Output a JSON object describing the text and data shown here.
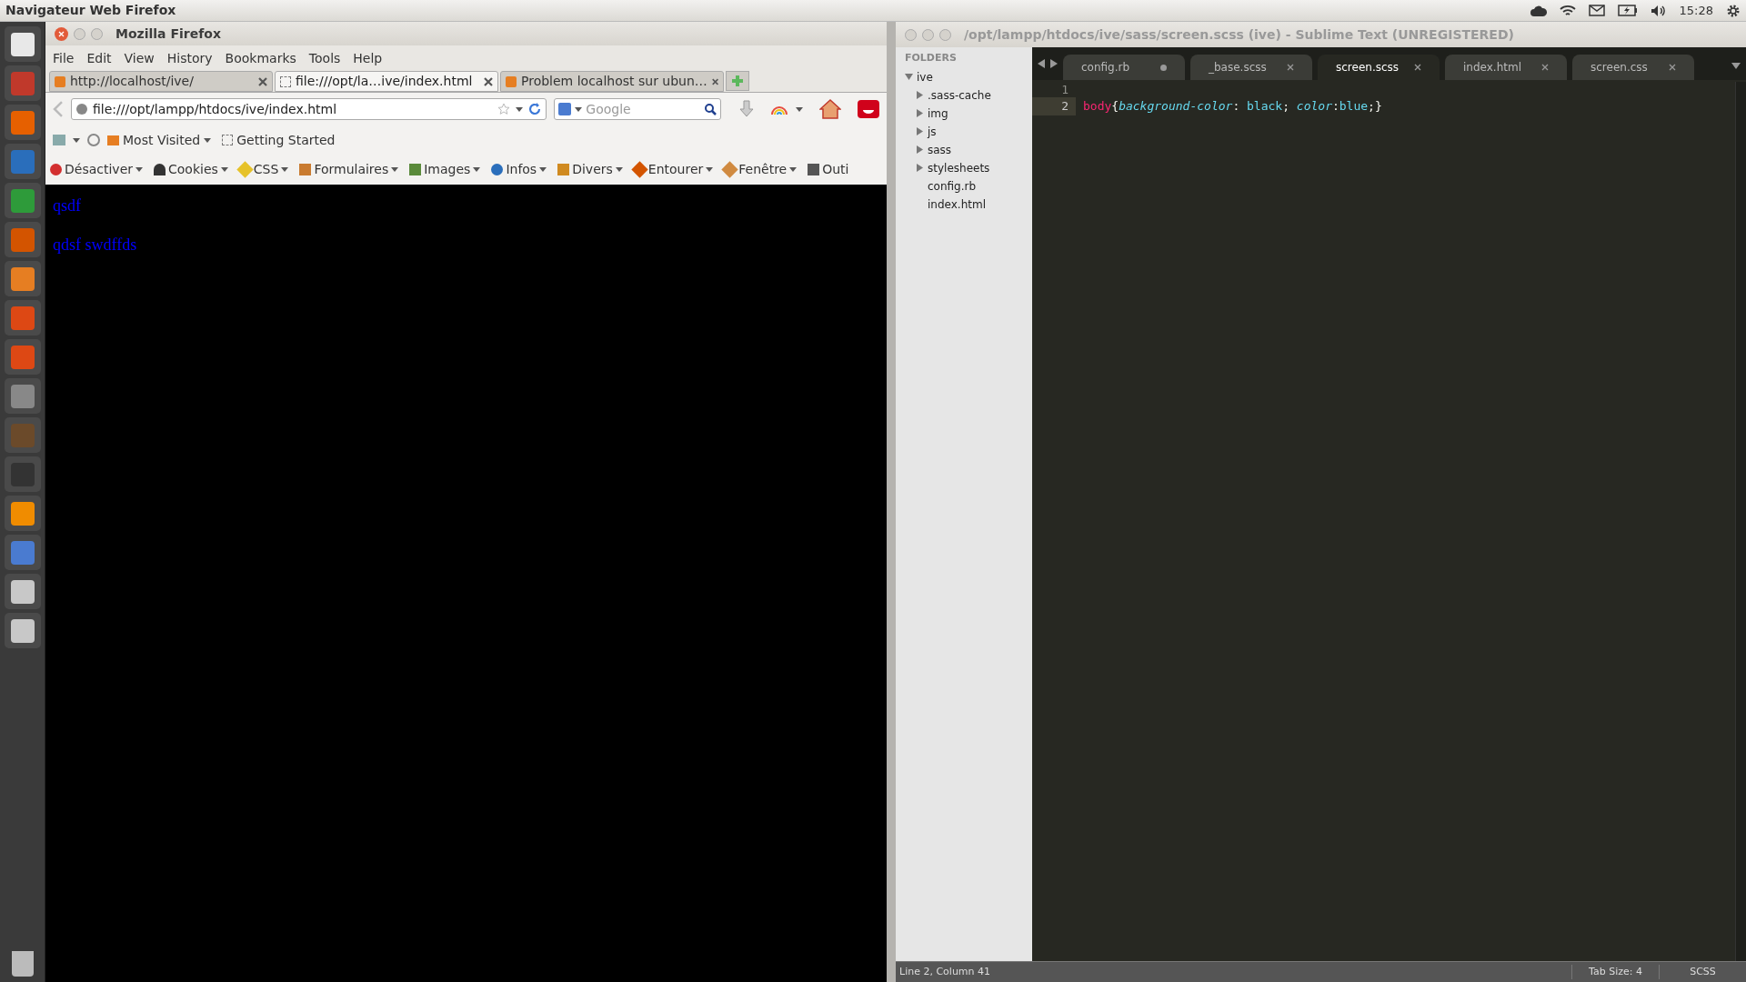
{
  "top_panel": {
    "title": "Navigateur Web Firefox",
    "time": "15:28"
  },
  "firefox": {
    "title": "Mozilla Firefox",
    "menu": [
      "File",
      "Edit",
      "View",
      "History",
      "Bookmarks",
      "Tools",
      "Help"
    ],
    "tabs": [
      {
        "label": "http://localhost/ive/",
        "selected": false
      },
      {
        "label": "file:///opt/la…ive/index.html",
        "selected": true
      },
      {
        "label": "Problem localhost sur ubun…",
        "selected": false
      }
    ],
    "url": "file:///opt/lampp/htdocs/ive/index.html",
    "search": {
      "placeholder": "Google"
    },
    "bookmarks": [
      "Most Visited",
      "Getting Started"
    ],
    "devtools": [
      "Désactiver",
      "Cookies",
      "CSS",
      "Formulaires",
      "Images",
      "Infos",
      "Divers",
      "Entourer",
      "Fenêtre",
      "Outi"
    ],
    "page": [
      "qsdf",
      "qdsf swdffds"
    ]
  },
  "sublime": {
    "title": "/opt/lampp/htdocs/ive/sass/screen.scss (ive) - Sublime Text (UNREGISTERED)",
    "sidebar": {
      "heading": "FOLDERS",
      "tree": [
        {
          "name": "ive",
          "expanded": true,
          "children": [
            {
              "name": ".sass-cache",
              "expanded": false
            },
            {
              "name": "img",
              "expanded": false
            },
            {
              "name": "js",
              "expanded": false
            },
            {
              "name": "sass",
              "expanded": false
            },
            {
              "name": "stylesheets",
              "expanded": false
            },
            {
              "name": "config.rb"
            },
            {
              "name": "index.html"
            }
          ]
        }
      ]
    },
    "tabs": [
      {
        "label": "config.rb",
        "selected": false,
        "modified": true
      },
      {
        "label": "_base.scss",
        "selected": false,
        "modified": false
      },
      {
        "label": "screen.scss",
        "selected": true,
        "modified": false
      },
      {
        "label": "index.html",
        "selected": false,
        "modified": false
      },
      {
        "label": "screen.css",
        "selected": false,
        "modified": false
      }
    ],
    "lines": [
      {
        "number": "1",
        "current": false
      },
      {
        "number": "2",
        "current": true,
        "tokens": [
          {
            "kind": "tag",
            "text": "body"
          },
          {
            "kind": "punct",
            "text": "{"
          },
          {
            "kind": "property",
            "text": "background-color"
          },
          {
            "kind": "punct",
            "text": ": "
          },
          {
            "kind": "value",
            "text": "black"
          },
          {
            "kind": "punct",
            "text": "; "
          },
          {
            "kind": "property",
            "text": "color"
          },
          {
            "kind": "punct",
            "text": ":"
          },
          {
            "kind": "value",
            "text": "blue"
          },
          {
            "kind": "punct",
            "text": ";}"
          }
        ]
      }
    ],
    "status": {
      "position": "Line 2, Column 41",
      "tab_size": "Tab Size: 4",
      "syntax": "SCSS"
    }
  }
}
